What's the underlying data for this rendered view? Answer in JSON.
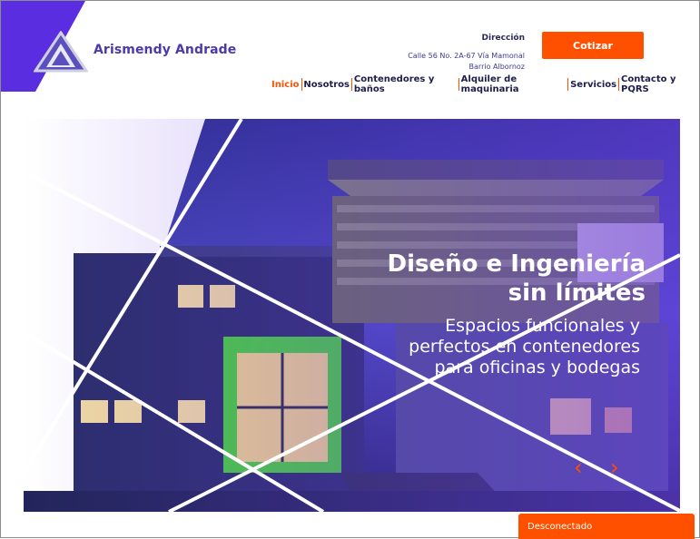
{
  "brand": {
    "name": "Arismendy Andrade"
  },
  "address": {
    "title": "Dirección",
    "line1": "Calle 56 No. 2A-67 Vía Mamonal",
    "line2": "Barrio Albornoz"
  },
  "cta": {
    "label": "Cotizar"
  },
  "nav": {
    "items": [
      {
        "label": "Inicio"
      },
      {
        "label": "Nosotros"
      },
      {
        "label": "Contenedores y baños"
      },
      {
        "label": "Alquiler de maquinaria"
      },
      {
        "label": "Servicios"
      },
      {
        "label": "Contacto y PQRS"
      }
    ]
  },
  "hero": {
    "title": "Diseño e Ingeniería\nsin límites",
    "subtitle": "Espacios funcionales y\nperfectos en contenedores\npara oficinas y bodegas",
    "prev_icon": "‹",
    "next_icon": "›"
  },
  "status": {
    "label": "Desconectado"
  },
  "colors": {
    "accent": "#ff5000",
    "brand": "#4b3aa8"
  }
}
